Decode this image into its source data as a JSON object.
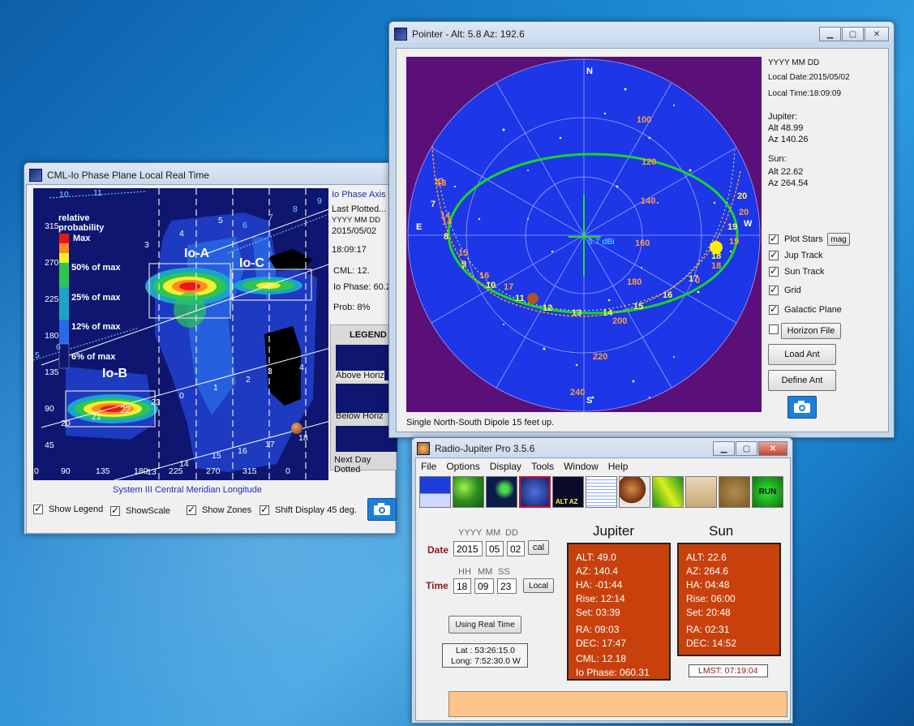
{
  "cml_window": {
    "title": "CML-Io Phase Plane Local Real Time",
    "plot": {
      "y_ticks": [
        "315",
        "270",
        "225",
        "180",
        "135",
        "90",
        "45"
      ],
      "x_ticks": [
        "0",
        "90",
        "135",
        "180",
        "225",
        "270",
        "315",
        "0"
      ],
      "legend_lines": [
        "relative",
        "probability",
        "Max",
        "50% of max",
        "25% of max",
        "12% of max",
        "6% of max"
      ],
      "zones": [
        "Io-A",
        "Io-C",
        "Io-B"
      ],
      "track_numbers": [
        "10",
        "11",
        "3",
        "4",
        "5",
        "6",
        "7",
        "8",
        "9",
        "5",
        "6",
        "21",
        "22",
        "23",
        "0",
        "1",
        "2",
        "3",
        "4",
        "13",
        "14",
        "15",
        "16",
        "17",
        "18",
        "20"
      ]
    },
    "x_axis_label": "System III Central Meridian Longitude",
    "side": {
      "io_phase_axis": "Io Phase Axis",
      "last_plotted": "Last Plotted...",
      "date_format": "YYYY MM DD",
      "date": "2015/05/02",
      "time": "18:09:17",
      "cml": "CML: 12.",
      "io_phase": "Io Phase: 60.2",
      "prob": "Prob:  8%",
      "legend_title": "LEGEND",
      "above_horizon": "Above Horiz",
      "below_horizon": "Below Horiz",
      "next_day": "Next Day Dotted"
    },
    "checkboxes": [
      {
        "label": "Show Legend",
        "checked": true
      },
      {
        "label": "ShowScale",
        "checked": true
      },
      {
        "label": "Show Zones",
        "checked": true
      },
      {
        "label": "Shift Display 45 deg.",
        "checked": true
      }
    ]
  },
  "pointer_window": {
    "title": "Pointer - Alt: 5.8   Az: 192.6",
    "sky": {
      "compass": {
        "n": "N",
        "s": "S",
        "e": "E",
        "w": "W"
      },
      "center_label": "5.7 dBi",
      "gain_labels": [
        "100",
        "120",
        "140",
        "160",
        "180",
        "200",
        "220",
        "240"
      ],
      "jupiter_hours": [
        "13",
        "14",
        "8",
        "9",
        "10",
        "11",
        "12",
        "13",
        "14",
        "15",
        "16",
        "17",
        "18",
        "19",
        "20",
        "7"
      ],
      "sun_hours": [
        "13",
        "14",
        "15",
        "16",
        "17",
        "18",
        "19",
        "20",
        "0"
      ]
    },
    "info": {
      "date_format": "YYYY MM DD",
      "local_date": "Local Date:2015/05/02",
      "local_time": "Local Time:18:09:09",
      "jupiter_label": "Jupiter:",
      "jupiter_alt": "Alt 48.99",
      "jupiter_az": "Az 140.26",
      "sun_label": "Sun:",
      "sun_alt": "Alt 22.62",
      "sun_az": "Az 264.54"
    },
    "checkboxes": [
      {
        "label": "Plot Stars",
        "checked": true
      },
      {
        "label": "Jup Track",
        "checked": true
      },
      {
        "label": "Sun Track",
        "checked": true
      },
      {
        "label": "Grid",
        "checked": true
      },
      {
        "label": "Galactic Plane",
        "checked": true
      }
    ],
    "mag_button": "mag",
    "horizon_file_button": "Horizon File",
    "load_ant_button": "Load Ant",
    "define_ant_button": "Define Ant",
    "antenna_caption": "Single North-South Dipole 15 feet up."
  },
  "rj_window": {
    "title": "Radio-Jupiter Pro   3.5.6",
    "menu": [
      "File",
      "Options",
      "Display",
      "Tools",
      "Window",
      "Help"
    ],
    "toolbar_tools": [
      "horizon-view",
      "globe",
      "jupiter-view",
      "sky-map",
      "alt-az",
      "notebook",
      "jupiter-io",
      "spectrum",
      "meter",
      "gear",
      "run"
    ],
    "toolbar_text": {
      "alt_az": "ALT AZ",
      "run": "RUN"
    },
    "date_labels": {
      "yyyy": "YYYY",
      "mm": "MM",
      "dd": "DD"
    },
    "date_label": "Date",
    "date_values": {
      "year": "2015",
      "month": "05",
      "day": "02"
    },
    "cal_button": "cal",
    "time_labels": {
      "hh": "HH",
      "mm": "MM",
      "ss": "SS"
    },
    "time_label": "Time",
    "time_values": {
      "hour": "18",
      "minute": "09",
      "second": "23"
    },
    "local_button": "Local",
    "real_time_button": "Using Real Time",
    "latitude": "Lat :  53:26:15.0",
    "longitude": "Long:  7:52:30.0  W",
    "jupiter_title": "Jupiter",
    "sun_title": "Sun",
    "jupiter": {
      "alt": "ALT: 49.0",
      "az": "AZ: 140.4",
      "ha": "HA: -01:44",
      "rise": "Rise: 12:14",
      "set": "Set: 03:39",
      "ra": "RA: 09:03",
      "dec": "DEC: 17:47",
      "cml": "CML:  12.18",
      "io_phase": "Io Phase: 060.31"
    },
    "sun": {
      "alt": "ALT: 22.6",
      "az": "AZ: 264.6",
      "ha": "HA: 04:48",
      "rise": "Rise: 06:00",
      "set": "Set: 20:48",
      "ra": "RA: 02:31",
      "dec": "DEC: 14:52"
    },
    "lmst": "LMST: 07:19:04",
    "status_bar": ""
  },
  "colors": {
    "plot_background": "#0e1670",
    "sky_disc": "#1c36e8",
    "sky_border": "#5b0f78",
    "info_box": "#c8410c",
    "status_bar": "#ffc489"
  }
}
